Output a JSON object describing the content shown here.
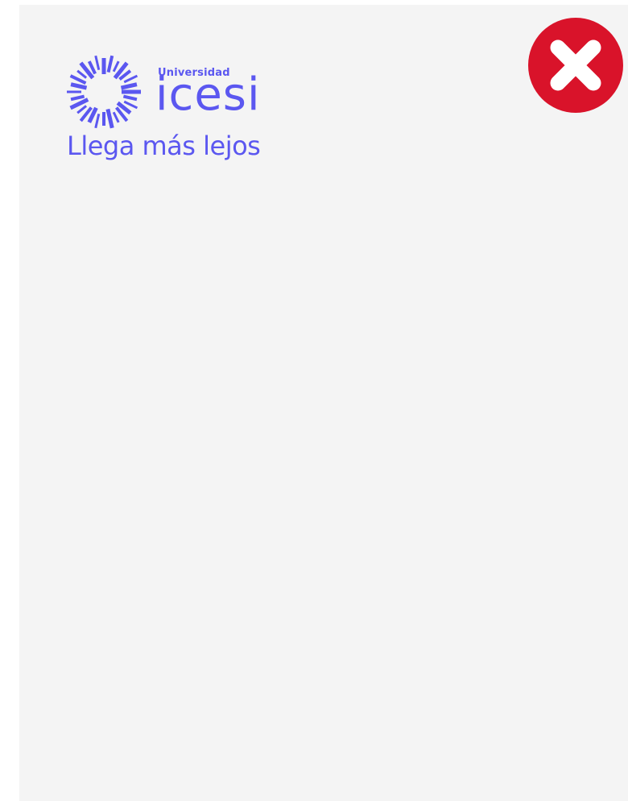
{
  "logo": {
    "university_label": "Universidad",
    "brand_name": "icesi",
    "tagline": "Llega más lejos",
    "brand_color": "#5b57f0"
  },
  "close_button": {
    "icon": "close-icon",
    "color": "#d9132a"
  }
}
